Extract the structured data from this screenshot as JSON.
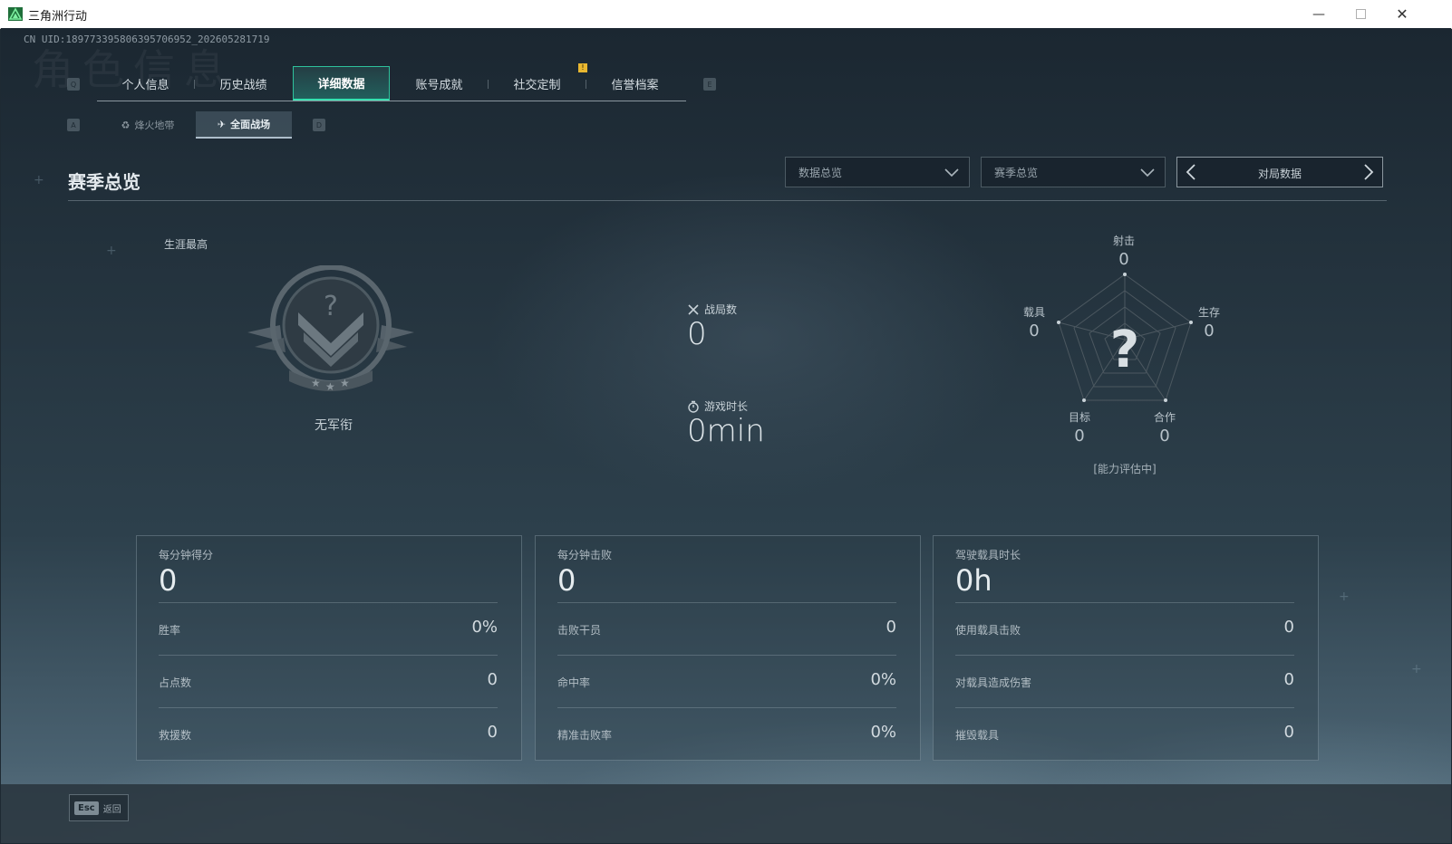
{
  "window": {
    "title": "三角洲行动",
    "controls": [
      "minimize",
      "maximize",
      "close"
    ]
  },
  "header": {
    "uid": "CN UID:18977339580639570695‌2_202605281719",
    "watermark": "角色信息"
  },
  "key_hints": {
    "tab_prev": "Q",
    "tab_next": "E",
    "sub_prev": "A",
    "sub_next": "D"
  },
  "tabs": [
    {
      "label": "个人信息"
    },
    {
      "label": "历史战绩"
    },
    {
      "label": "详细数据",
      "active": true
    },
    {
      "label": "账号成就"
    },
    {
      "label": "社交定制"
    },
    {
      "label": "信誉档案"
    }
  ],
  "notification": "!",
  "subtabs": [
    {
      "label": "烽火地带",
      "icon": "recycle-icon"
    },
    {
      "label": "全面战场",
      "icon": "aircraft-icon",
      "active": true
    }
  ],
  "section": {
    "title": "赛季总览"
  },
  "filters": {
    "dropdown1": "数据总览",
    "dropdown2": "赛季总览",
    "pager_label": "对局数据"
  },
  "career": {
    "label": "生涯最高",
    "rank_name": "无军衔"
  },
  "center_stats": {
    "matches_label": "战局数",
    "matches_value": "0",
    "playtime_label": "游戏时长",
    "playtime_value": "0min"
  },
  "radar": {
    "placeholder": "?",
    "axes": [
      {
        "label": "射击",
        "value": "0"
      },
      {
        "label": "生存",
        "value": "0"
      },
      {
        "label": "合作",
        "value": "0"
      },
      {
        "label": "目标",
        "value": "0"
      },
      {
        "label": "载具",
        "value": "0"
      }
    ],
    "status": "[能力评估中]"
  },
  "cards": [
    {
      "title": "每分钟得分",
      "value": "0",
      "rows": [
        {
          "label": "胜率",
          "value": "0%"
        },
        {
          "label": "占点数",
          "value": "0"
        },
        {
          "label": "救援数",
          "value": "0"
        }
      ]
    },
    {
      "title": "每分钟击败",
      "value": "0",
      "rows": [
        {
          "label": "击败干员",
          "value": "0"
        },
        {
          "label": "命中率",
          "value": "0%"
        },
        {
          "label": "精准击败率",
          "value": "0%"
        }
      ]
    },
    {
      "title": "驾驶载具时长",
      "value": "0h",
      "rows": [
        {
          "label": "使用载具击败",
          "value": "0"
        },
        {
          "label": "对载具造成伤害",
          "value": "0"
        },
        {
          "label": "摧毁载具",
          "value": "0"
        }
      ]
    }
  ],
  "footer": {
    "esc_key": "Esc",
    "esc_label": "返回"
  },
  "colors": {
    "accent": "#2ec29c",
    "notify": "#e8b730",
    "titlebar": "#ffffff",
    "background": "#1e2a33"
  }
}
